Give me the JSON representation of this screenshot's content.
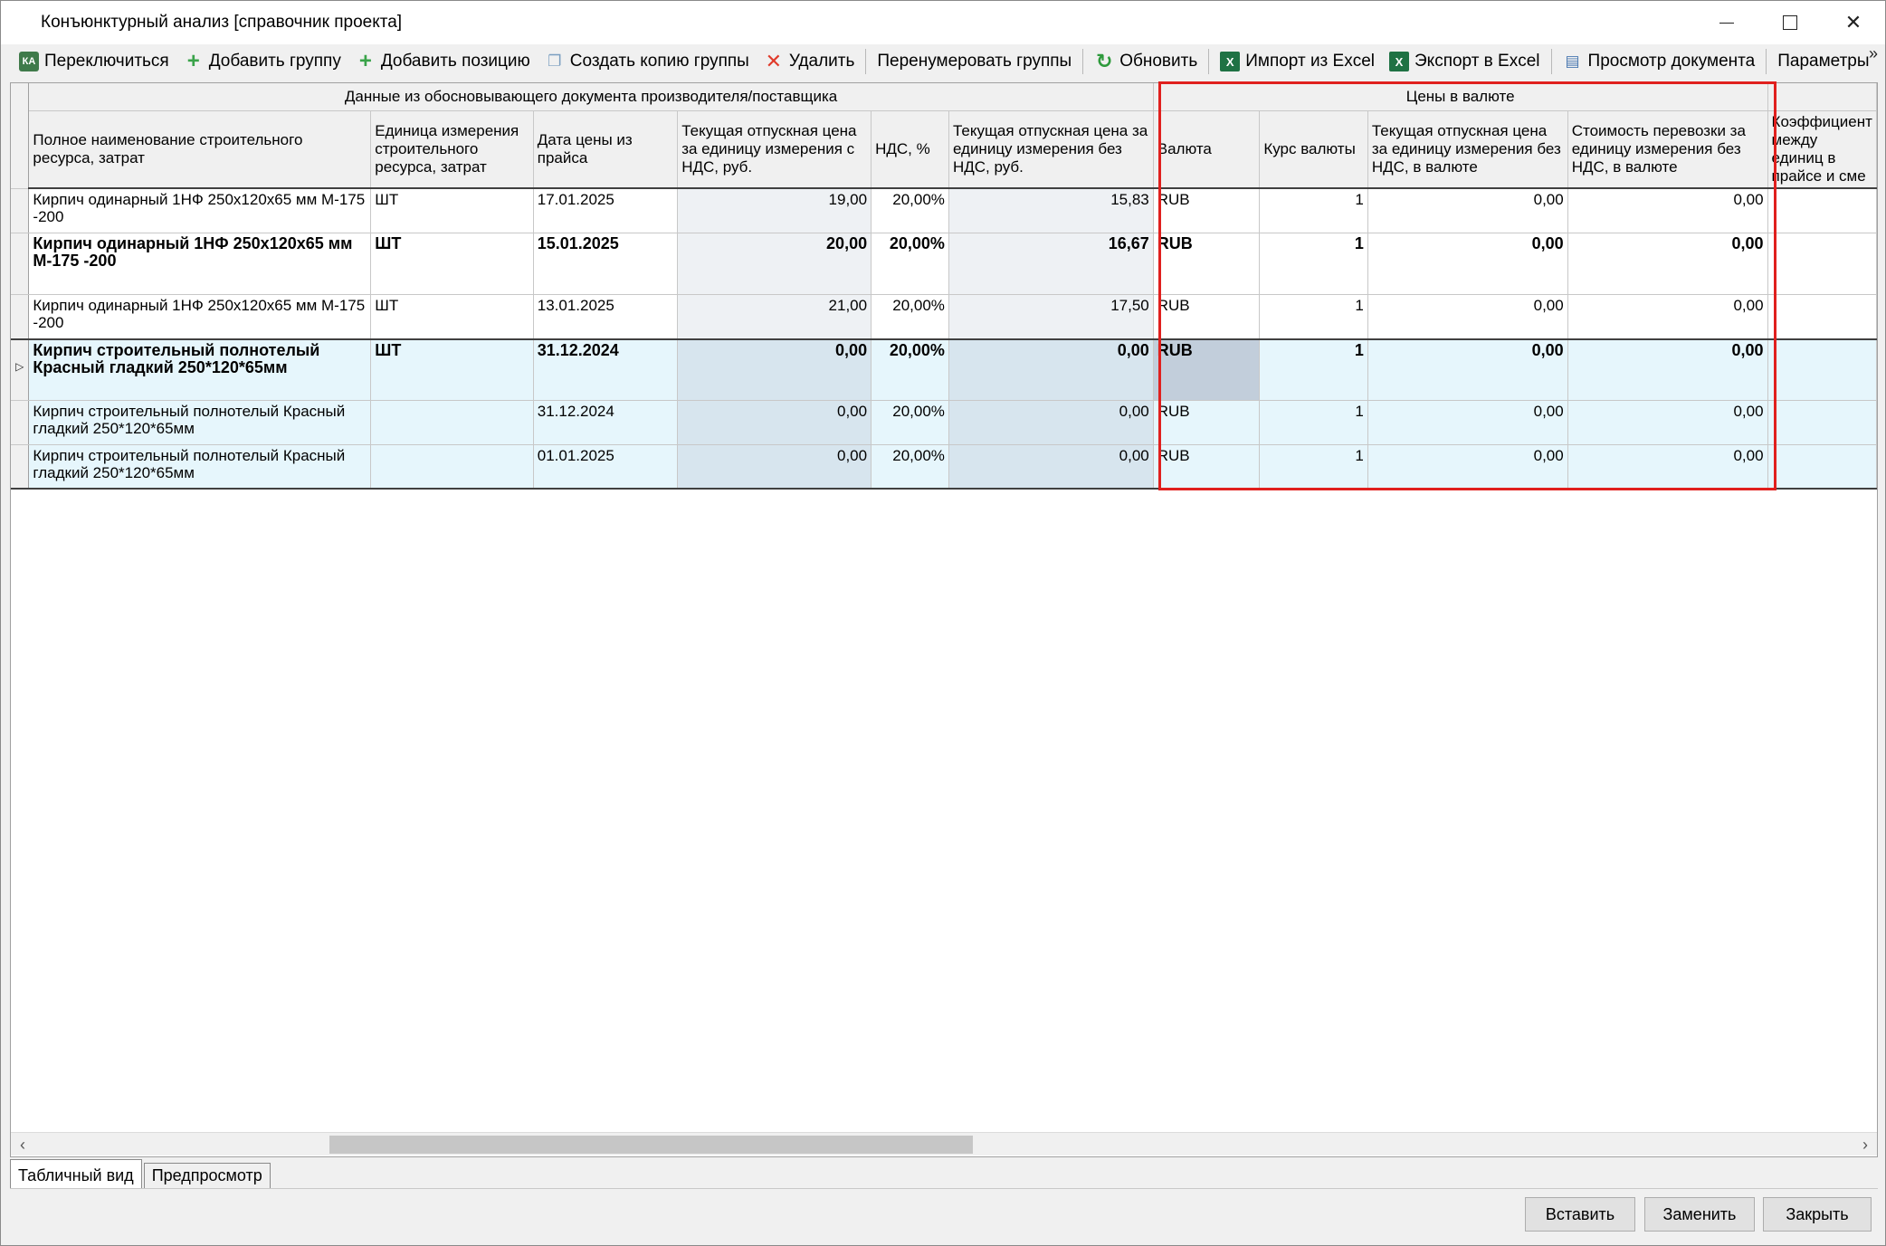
{
  "window": {
    "title": "Конъюнктурный анализ [справочник проекта]"
  },
  "toolbar": {
    "switch": "Переключиться",
    "add_group": "Добавить группу",
    "add_position": "Добавить позицию",
    "copy_group": "Создать копию группы",
    "delete": "Удалить",
    "renumber": "Перенумеровать группы",
    "refresh": "Обновить",
    "import_excel": "Импорт из Excel",
    "export_excel": "Экспорт в Excel",
    "view_doc": "Просмотр документа",
    "params": "Параметры",
    "more": "»"
  },
  "grid": {
    "group_headers": {
      "supplier": "Данные из обосновывающего документа производителя/поставщика",
      "currency": "Цены в валюте"
    },
    "columns": {
      "name": "Полное наименование строительного ресурса, затрат",
      "unit": "Единица измерения строительного ресурса, затрат",
      "date": "Дата цены из прайса",
      "price_vat": "Текущая отпускная цена за единицу измерения с НДС, руб.",
      "vat": "НДС, %",
      "price_novat": "Текущая отпускная цена за единицу измерения без НДС, руб.",
      "currency": "Валюта",
      "rate": "Курс валюты",
      "price_cur": "Текущая отпускная цена за единицу измерения без НДС, в валюте",
      "transport_cur": "Стоимость перевозки за единицу измерения без НДС, в валюте",
      "coef": "Коэффициент между единиц в прайсе и сме"
    },
    "rows": [
      {
        "name": "Кирпич одинарный 1НФ 250x120x65 мм М-175 -200",
        "unit": "ШТ",
        "date": "17.01.2025",
        "price_vat": "19,00",
        "vat": "20,00%",
        "price_novat": "15,83",
        "currency": "RUB",
        "rate": "1",
        "price_cur": "0,00",
        "transport_cur": "0,00"
      },
      {
        "name": "Кирпич одинарный 1НФ 250x120x65 мм М-175 -200",
        "unit": "ШТ",
        "date": "15.01.2025",
        "price_vat": "20,00",
        "vat": "20,00%",
        "price_novat": "16,67",
        "currency": "RUB",
        "rate": "1",
        "price_cur": "0,00",
        "transport_cur": "0,00"
      },
      {
        "name": "Кирпич одинарный 1НФ 250x120x65 мм М-175 -200",
        "unit": "ШТ",
        "date": "13.01.2025",
        "price_vat": "21,00",
        "vat": "20,00%",
        "price_novat": "17,50",
        "currency": "RUB",
        "rate": "1",
        "price_cur": "0,00",
        "transport_cur": "0,00"
      },
      {
        "name": "Кирпич строительный полнотелый Красный гладкий 250*120*65мм",
        "unit": "ШТ",
        "date": "31.12.2024",
        "price_vat": "0,00",
        "vat": "20,00%",
        "price_novat": "0,00",
        "currency": "RUB",
        "rate": "1",
        "price_cur": "0,00",
        "transport_cur": "0,00"
      },
      {
        "name": "Кирпич строительный полнотелый Красный гладкий 250*120*65мм",
        "unit": "",
        "date": "31.12.2024",
        "price_vat": "0,00",
        "vat": "20,00%",
        "price_novat": "0,00",
        "currency": "RUB",
        "rate": "1",
        "price_cur": "0,00",
        "transport_cur": "0,00"
      },
      {
        "name": "Кирпич строительный полнотелый Красный гладкий 250*120*65мм",
        "unit": "",
        "date": "01.01.2025",
        "price_vat": "0,00",
        "vat": "20,00%",
        "price_novat": "0,00",
        "currency": "RUB",
        "rate": "1",
        "price_cur": "0,00",
        "transport_cur": "0,00"
      }
    ]
  },
  "tabs": {
    "table_view": "Табличный вид",
    "preview": "Предпросмотр"
  },
  "buttons": {
    "insert": "Вставить",
    "replace": "Заменить",
    "close": "Закрыть"
  },
  "colors": {
    "highlight": "#e0201e",
    "selected_row": "#e6f6fc"
  }
}
